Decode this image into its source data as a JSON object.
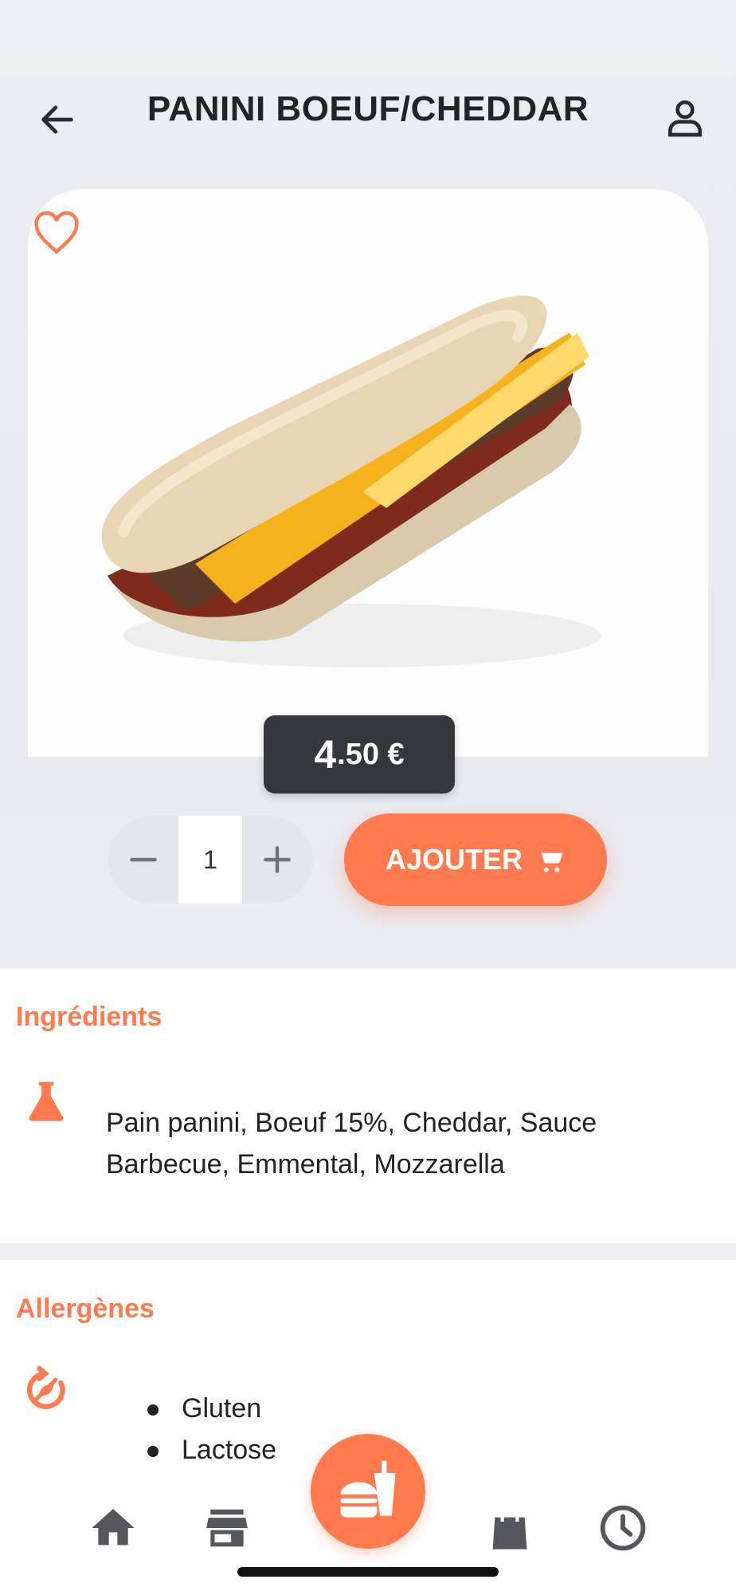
{
  "header": {
    "title": "PANINI BOEUF/CHEDDAR",
    "back_icon": "arrow-left-icon",
    "profile_icon": "user-icon"
  },
  "product": {
    "image_alt": "panini sandwich with beef, cheddar and barbecue sauce",
    "favorite_icon": "heart-outline-icon",
    "price_int": "4",
    "price_dec": ".50 €"
  },
  "cart": {
    "quantity": "1",
    "decrement_icon": "minus-icon",
    "increment_icon": "plus-icon",
    "add_label": "AJOUTER",
    "cart_icon": "shopping-cart-icon"
  },
  "ingredients": {
    "title": "Ingrédients",
    "icon": "flask-icon",
    "text": "Pain panini, Boeuf 15%, Cheddar, Sauce Barbecue, Emmental, Mozzarella"
  },
  "allergens": {
    "title": "Allergènes",
    "icon": "allergen-icon",
    "items": [
      "Gluten",
      "Lactose"
    ]
  },
  "bottom_nav": {
    "items": [
      "home-icon",
      "store-icon",
      "menu-fab-icon",
      "bag-icon",
      "clock-icon"
    ]
  },
  "colors": {
    "accent": "#ff7b4f",
    "price_bg": "#34373b"
  }
}
